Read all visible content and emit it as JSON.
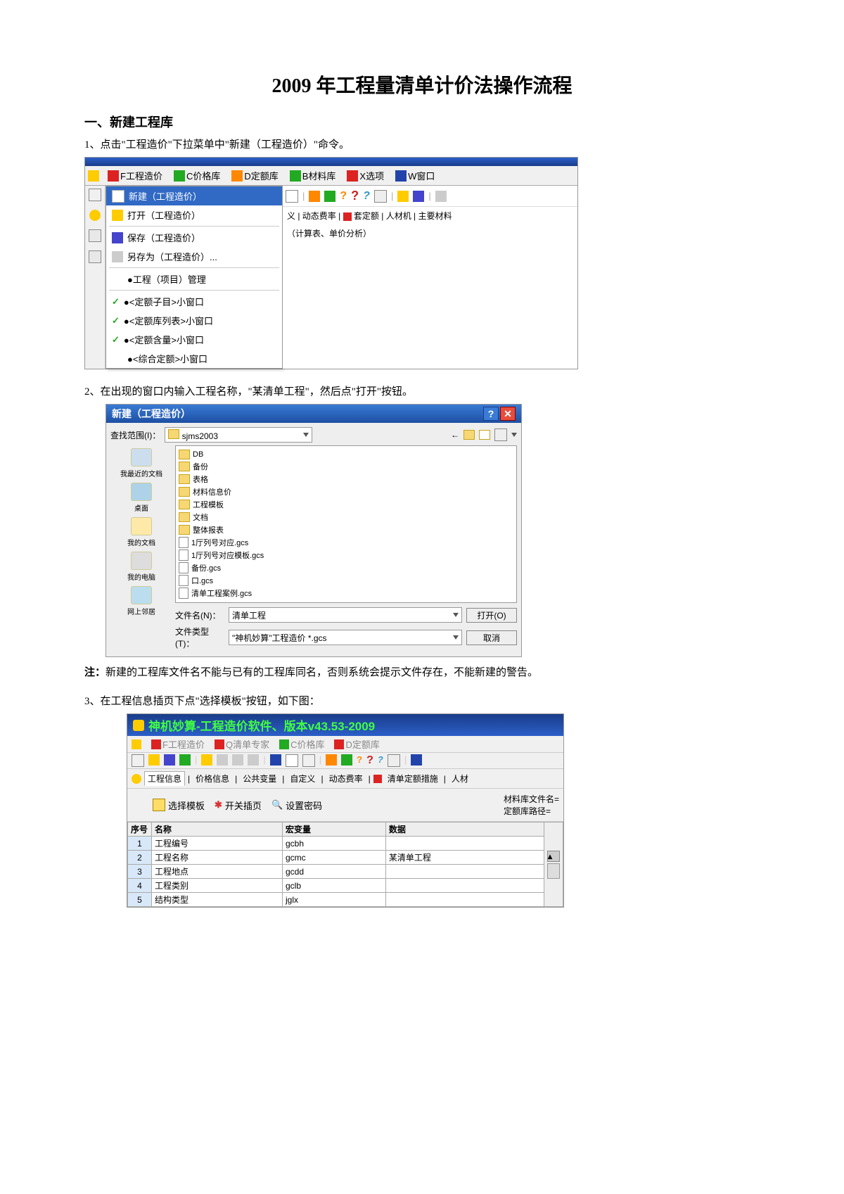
{
  "title": "2009 年工程量清单计价法操作流程",
  "section1": "一、新建工程库",
  "step1": "1、点击\"工程造价\"下拉菜单中\"新建（工程造价）\"命令。",
  "step2": "2、在出现的窗口内输入工程名称，\"某清单工程\"，然后点\"打开\"按钮。",
  "note_label": "注：",
  "note": "新建的工程库文件名不能与已有的工程库同名，否则系统会提示文件存在，不能新建的警告。",
  "step3": "3、在工程信息插页下点\"选择模板\"按钮，如下图：",
  "s1": {
    "menuF": "F工程造价",
    "menuC": "C价格库",
    "menuD": "D定额库",
    "menuB": "B材料库",
    "menuX": "X选项",
    "menuW": "W窗口",
    "dropdown": {
      "new": "新建（工程造价）",
      "open": "打开（工程造价）",
      "save": "保存（工程造价）",
      "saveas": "另存为（工程造价）...",
      "proj": "●工程（项目）管理",
      "sub1": "●<定额子目>小窗口",
      "sub2": "●<定额库列表>小窗口",
      "sub3": "●<定额含量>小窗口",
      "sub4": "●<综合定额>小窗口"
    },
    "tabs1": "义 | 动态费率 | ",
    "tabs1b": " 套定额 | 人材机 | 主要材料",
    "tabs2": "（计算表、单价分析）"
  },
  "s2": {
    "title": "新建（工程造价）",
    "lookin_label": "查找范围(I)：",
    "lookin_value": "sjms2003",
    "side": {
      "recent": "我最近的文档",
      "desktop": "桌面",
      "mydocs": "我的文档",
      "mycomp": "我的电脑",
      "network": "网上邻居"
    },
    "files": [
      "DB",
      "备份",
      "表格",
      "材料信息价",
      "工程模板",
      "文档",
      "整体报表",
      "1厅列号对应.gcs",
      "1厅列号对应模板.gcs",
      "备份.gcs",
      "口.gcs",
      "清单工程案例.gcs"
    ],
    "filename_label": "文件名(N)：",
    "filename_value": "清单工程",
    "filetype_label": "文件类型(T)：",
    "filetype_value": "\"神机妙算\"工程造价 *.gcs",
    "btn_open": "打开(O)",
    "btn_cancel": "取消"
  },
  "s3": {
    "app_title": "神机妙算-工程造价软件、版本v43.53-2009",
    "mF": "F工程造价",
    "mQ": "Q清单专家",
    "mC": "C价格库",
    "mD": "D定额库",
    "tabs": {
      "t1": "工程信息",
      "t2": "价格信息",
      "t3": "公共变量",
      "t4": "自定义",
      "t5": "动态费率",
      "t6": "清单定额措施",
      "t7": "人材"
    },
    "btn_template": "选择模板",
    "btn_switch": "开关插页",
    "btn_password": "设置密码",
    "label_matfile": "材料库文件名=",
    "label_quotapath": "定额库路径=",
    "thead": {
      "c1": "序号",
      "c2": "名称",
      "c3": "宏变量",
      "c4": "数据"
    },
    "rows": [
      {
        "n": "1",
        "name": "工程编号",
        "var": "gcbh",
        "data": ""
      },
      {
        "n": "2",
        "name": "工程名称",
        "var": "gcmc",
        "data": "某清单工程"
      },
      {
        "n": "3",
        "name": "工程地点",
        "var": "gcdd",
        "data": ""
      },
      {
        "n": "4",
        "name": "工程类别",
        "var": "gclb",
        "data": ""
      },
      {
        "n": "5",
        "name": "结构类型",
        "var": "jglx",
        "data": ""
      }
    ]
  }
}
